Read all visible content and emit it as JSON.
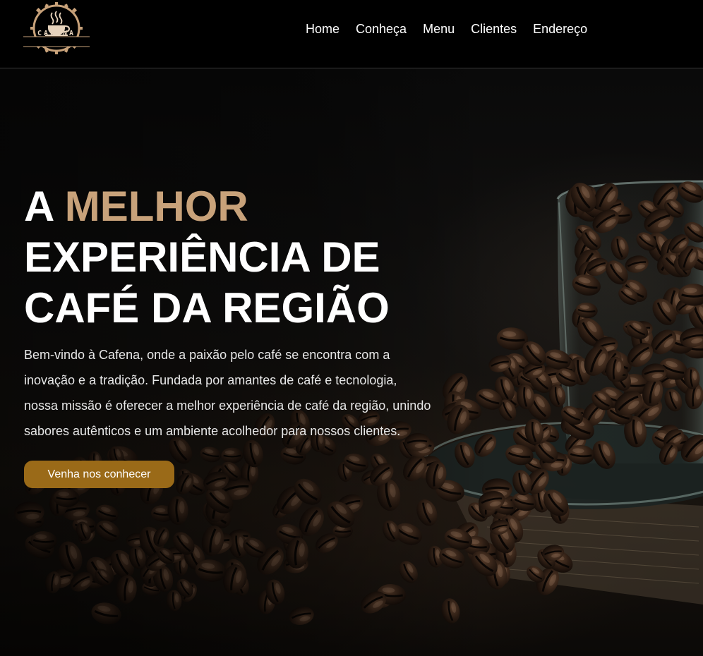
{
  "logo": {
    "brand": "CAFENA",
    "icon": "coffee-cup-icon"
  },
  "nav": {
    "items": [
      {
        "label": "Home"
      },
      {
        "label": "Conheça"
      },
      {
        "label": "Menu"
      },
      {
        "label": "Clientes"
      },
      {
        "label": "Endereço"
      }
    ]
  },
  "hero": {
    "title_prefix": "A",
    "title_accent": "MELHOR",
    "title_rest": "EXPERIÊNCIA DE CAFÉ DA REGIÃO",
    "description": "Bem-vindo à Cafena, onde a paixão pelo café se encontra com a inovação e a tradição. Fundada por amantes de café e tecnologia, nossa missão é oferecer a melhor experiência de café da região, unindo sabores autênticos e um ambiente acolhedor para nossos clientes.",
    "cta_label": "Venha nos conhecer"
  },
  "colors": {
    "accent": "#c8a27a",
    "button": "#9a6a18",
    "header_bg": "#000000"
  }
}
